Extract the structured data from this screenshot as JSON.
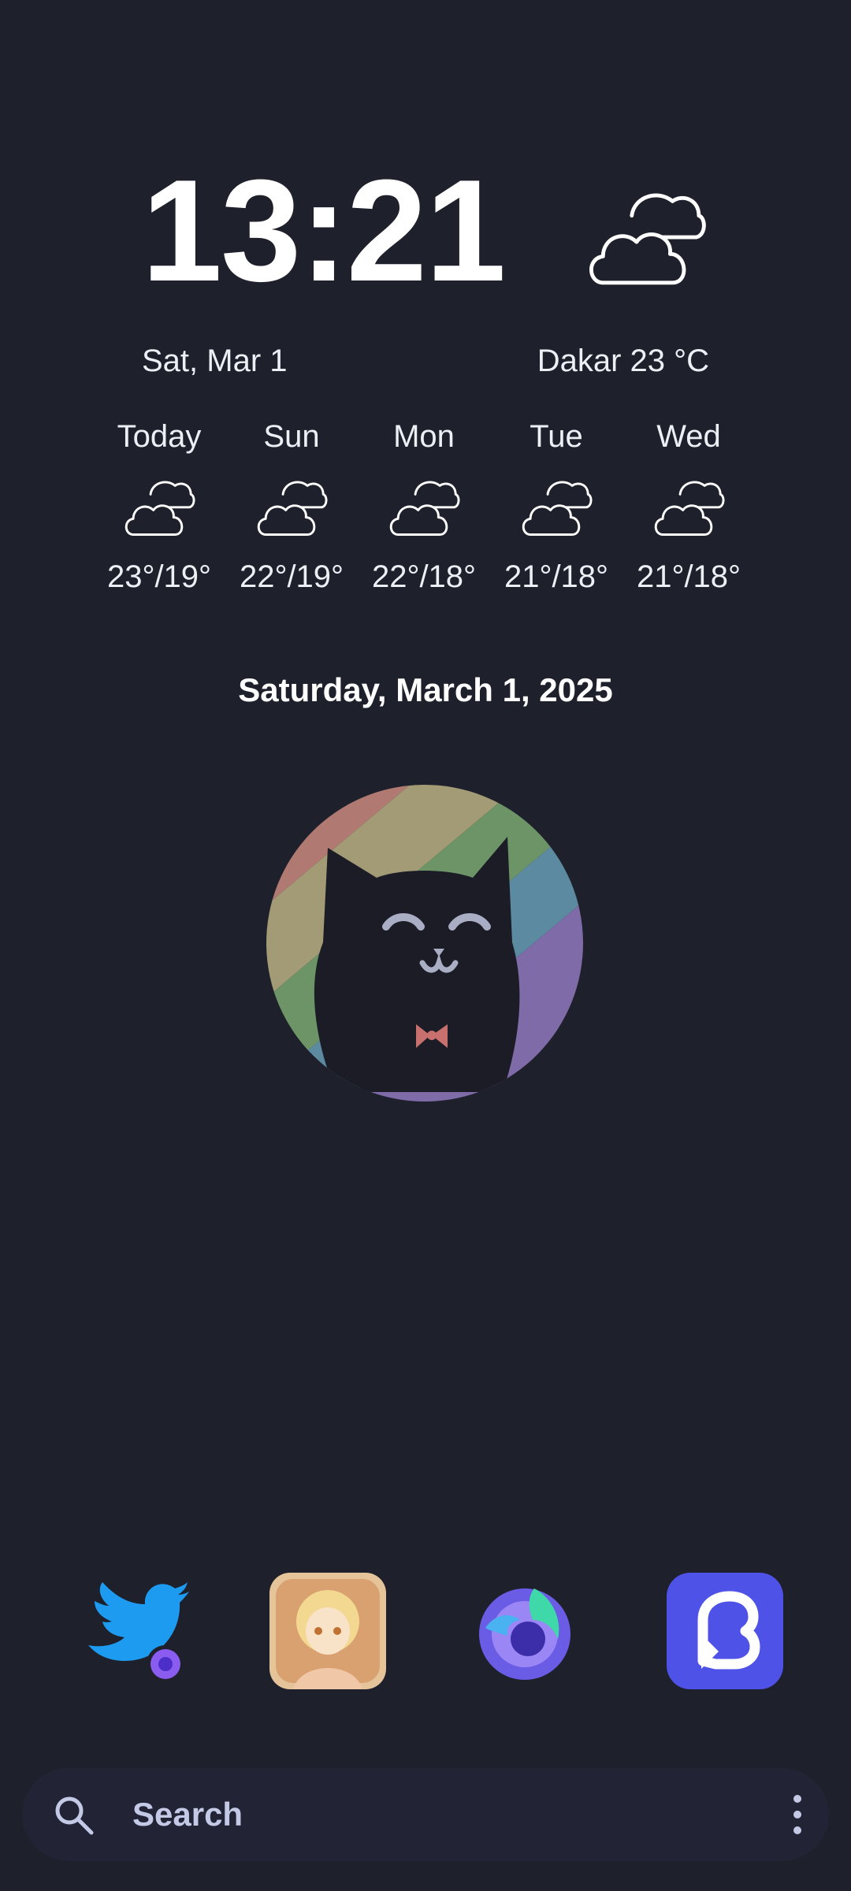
{
  "clock": {
    "time": "13:21"
  },
  "weather": {
    "date_short": "Sat, Mar 1",
    "location_temp": "Dakar 23 °C",
    "current_icon": "cloudy-icon",
    "forecast": [
      {
        "day": "Today",
        "icon": "cloudy-icon",
        "temp": "23°/19°"
      },
      {
        "day": "Sun",
        "icon": "cloudy-icon",
        "temp": "22°/19°"
      },
      {
        "day": "Mon",
        "icon": "cloudy-icon",
        "temp": "22°/18°"
      },
      {
        "day": "Tue",
        "icon": "cloudy-icon",
        "temp": "21°/18°"
      },
      {
        "day": "Wed",
        "icon": "cloudy-icon",
        "temp": "21°/18°"
      }
    ]
  },
  "date_long": "Saturday, March 1, 2025",
  "dock": {
    "apps": [
      {
        "icon": "twitter-bird-icon",
        "badge": "firefox-badge-icon"
      },
      {
        "icon": "anime-avatar-icon"
      },
      {
        "icon": "firefox-nightly-icon"
      },
      {
        "icon": "chat-app-icon"
      }
    ]
  },
  "search": {
    "label": "Search",
    "icon": "search-icon",
    "menu_icon": "more-vert-icon"
  },
  "colors": {
    "background": "#1e202c",
    "search_bar": "#222436",
    "search_text": "#c4cae6",
    "chat_app": "#4f52e6",
    "twitter_blue": "#1d9bf0"
  }
}
